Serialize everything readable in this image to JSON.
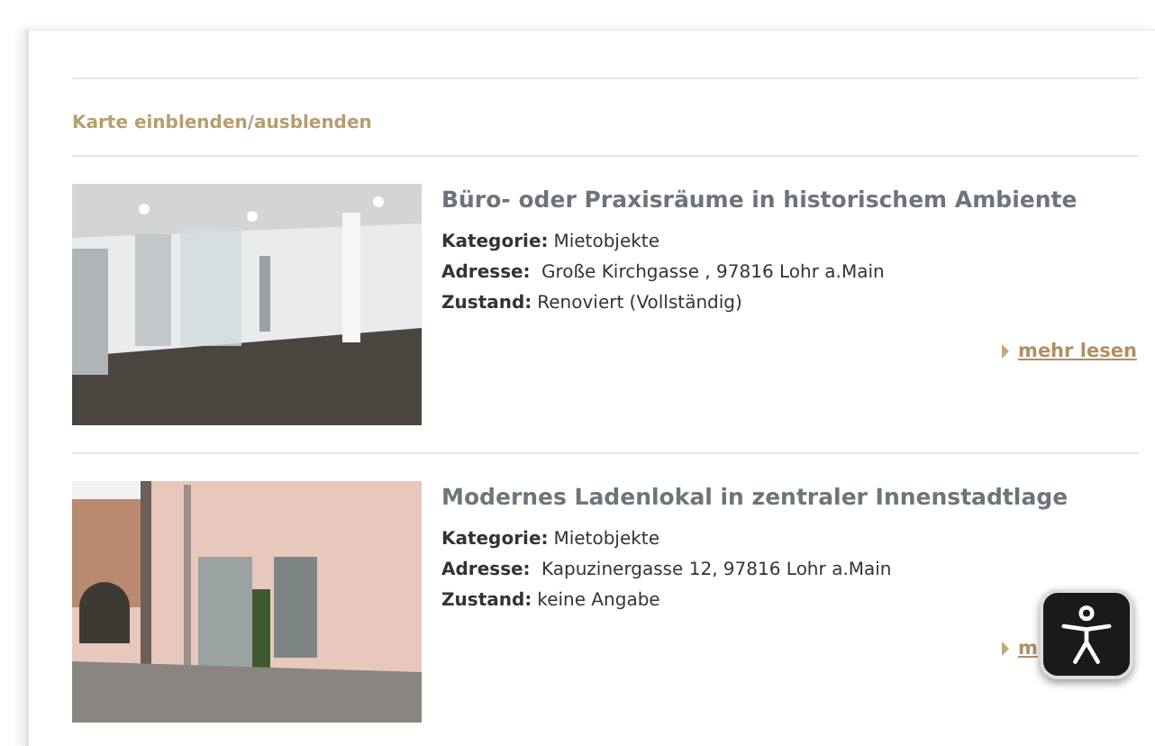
{
  "map_toggle": "Karte einblenden/ausblenden",
  "listings": [
    {
      "kind": "office",
      "title": "Büro- oder Praxisräume in historischem Ambiente",
      "fields": [
        {
          "label": "Kategorie:",
          "value": "Mietobjekte"
        },
        {
          "label": "Adresse:",
          "value": " Große Kirchgasse , 97816 Lohr a.Main"
        },
        {
          "label": "Zustand:",
          "value": "Renoviert (Vollständig)"
        }
      ],
      "more": "mehr lesen"
    },
    {
      "kind": "street",
      "title": "Modernes Ladenlokal in zentraler Innenstadtlage",
      "fields": [
        {
          "label": "Kategorie:",
          "value": "Mietobjekte"
        },
        {
          "label": "Adresse:",
          "value": " Kapuzinergasse 12, 97816 Lohr a.Main"
        },
        {
          "label": "Zustand:",
          "value": "keine Angabe"
        }
      ],
      "more": "m"
    }
  ]
}
